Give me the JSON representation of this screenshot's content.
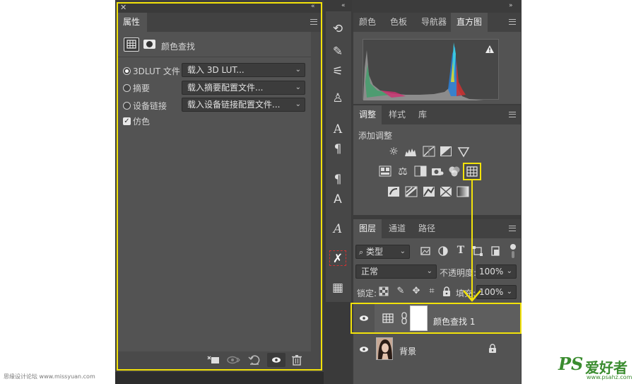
{
  "properties": {
    "tab": "属性",
    "title": "颜色查找",
    "options": [
      {
        "label": "3DLUT 文件",
        "value": "载入 3D LUT...",
        "selected": true
      },
      {
        "label": "摘要",
        "value": "载入摘要配置文件...",
        "selected": false
      },
      {
        "label": "设备链接",
        "value": "载入设备链接配置文件...",
        "selected": false
      }
    ],
    "dither_label": "仿色",
    "dither_checked": true
  },
  "top_tabs": [
    "颜色",
    "色板",
    "导航器",
    "直方图"
  ],
  "adjust_tabs": [
    "调整",
    "样式",
    "库"
  ],
  "adjust_add_label": "添加调整",
  "layers": {
    "tabs": [
      "图层",
      "通道",
      "路径"
    ],
    "kind_filter": "类型",
    "blend_mode": "正常",
    "opacity_label": "不透明度:",
    "opacity_value": "100%",
    "lock_label": "锁定:",
    "fill_label": "填充:",
    "fill_value": "100%",
    "items": [
      {
        "name": "颜色查找 1",
        "visible": true,
        "selected": true
      },
      {
        "name": "背景",
        "visible": true,
        "locked": true
      }
    ]
  },
  "watermark_left": "思缘设计论坛 www.missyuan.com",
  "logo": {
    "ps": "PS",
    "cn": "爱好者",
    "url": "www.psahz.com"
  },
  "highlight_color": "#f2e20a"
}
